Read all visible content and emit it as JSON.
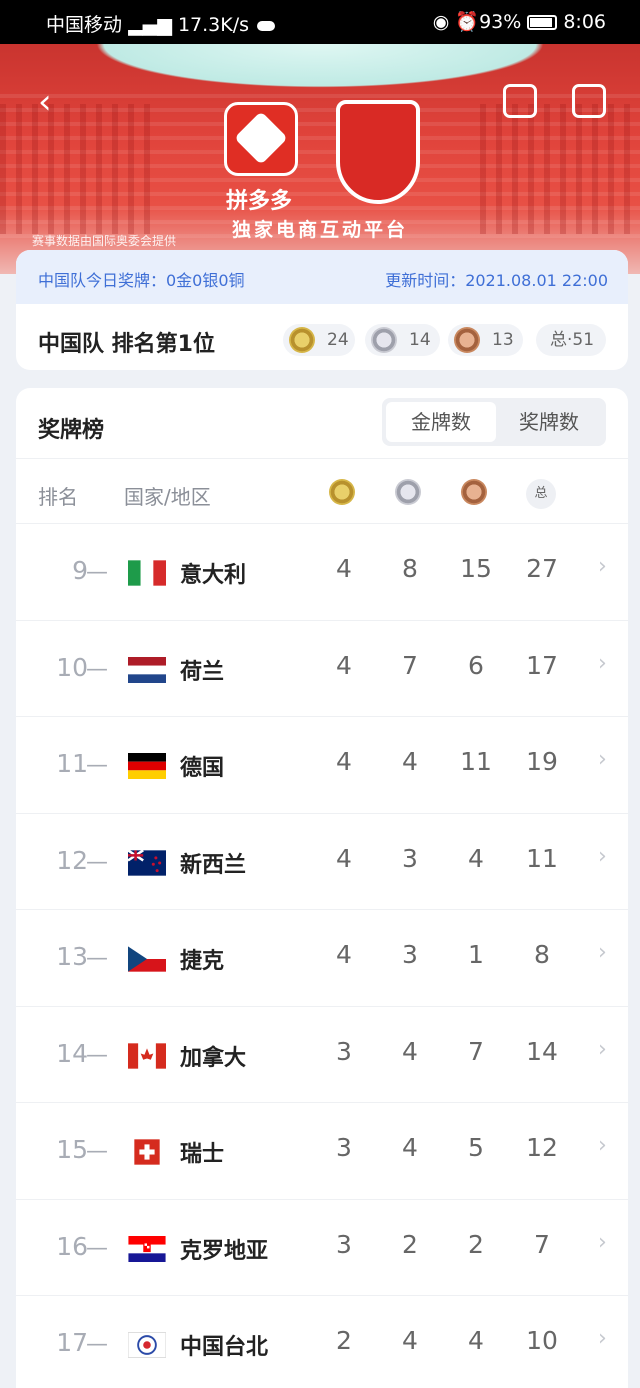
{
  "status": {
    "carrier": "中国移动",
    "net": "17.3K/s",
    "battery": "93%",
    "time": "8:06"
  },
  "hero": {
    "brand": "拼多多",
    "platform": "独家电商互动平台",
    "provider": "赛事数据由国际奥委会提供"
  },
  "summary": {
    "today": "中国队今日奖牌：0金0银0铜",
    "updated": "更新时间：2021.08.01 22:00",
    "rank": "中国队 排名第1位",
    "gold": "24",
    "silver": "14",
    "bronze": "13",
    "total": "总·51"
  },
  "board": {
    "title": "奖牌榜",
    "tabs": [
      "金牌数",
      "奖牌数"
    ],
    "col_rank": "排名",
    "col_country": "国家/地区",
    "col_total": "总"
  },
  "rows": [
    {
      "rank": "9",
      "name": "意大利",
      "g": "4",
      "s": "8",
      "b": "15",
      "t": "27"
    },
    {
      "rank": "10",
      "name": "荷兰",
      "g": "4",
      "s": "7",
      "b": "6",
      "t": "17"
    },
    {
      "rank": "11",
      "name": "德国",
      "g": "4",
      "s": "4",
      "b": "11",
      "t": "19"
    },
    {
      "rank": "12",
      "name": "新西兰",
      "g": "4",
      "s": "3",
      "b": "4",
      "t": "11"
    },
    {
      "rank": "13",
      "name": "捷克",
      "g": "4",
      "s": "3",
      "b": "1",
      "t": "8"
    },
    {
      "rank": "14",
      "name": "加拿大",
      "g": "3",
      "s": "4",
      "b": "7",
      "t": "14"
    },
    {
      "rank": "15",
      "name": "瑞士",
      "g": "3",
      "s": "4",
      "b": "5",
      "t": "12"
    },
    {
      "rank": "16",
      "name": "克罗地亚",
      "g": "3",
      "s": "2",
      "b": "2",
      "t": "7"
    },
    {
      "rank": "17",
      "name": "中国台北",
      "g": "2",
      "s": "4",
      "b": "4",
      "t": "10"
    }
  ]
}
